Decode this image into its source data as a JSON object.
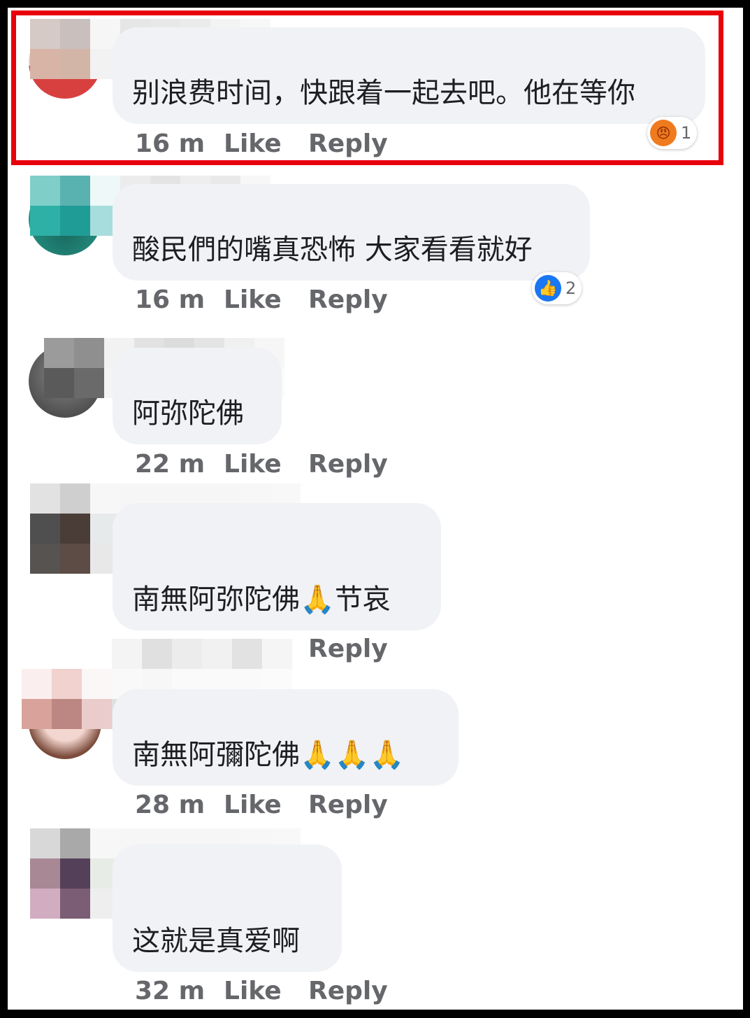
{
  "comments": [
    {
      "text": "别浪费时间，快跟着一起去吧。他在等你",
      "time": "16 m",
      "like": "Like",
      "reply": "Reply",
      "reaction": {
        "icon": "angry-emoji",
        "count": "1",
        "color": "#f07a1e"
      }
    },
    {
      "text": "酸民們的嘴真恐怖 大家看看就好",
      "time": "16 m",
      "like": "Like",
      "reply": "Reply",
      "reaction": {
        "icon": "thumbs-up",
        "count": "2",
        "color": "#1877f2"
      }
    },
    {
      "text": "阿弥陀佛",
      "time": "22 m",
      "like": "Like",
      "reply": "Reply"
    },
    {
      "text": "南無阿弥陀佛",
      "text_suffix": "节哀",
      "emoji": "🙏",
      "time": "",
      "like": "",
      "reply": "Reply"
    },
    {
      "text": "南無阿彌陀佛",
      "emoji": "🙏🙏🙏",
      "time": "28 m",
      "like": "Like",
      "reply": "Reply"
    },
    {
      "text": "这就是真爱啊",
      "time": "32 m",
      "like": "Like",
      "reply": "Reply"
    }
  ],
  "highlight_color": "#e8000b"
}
